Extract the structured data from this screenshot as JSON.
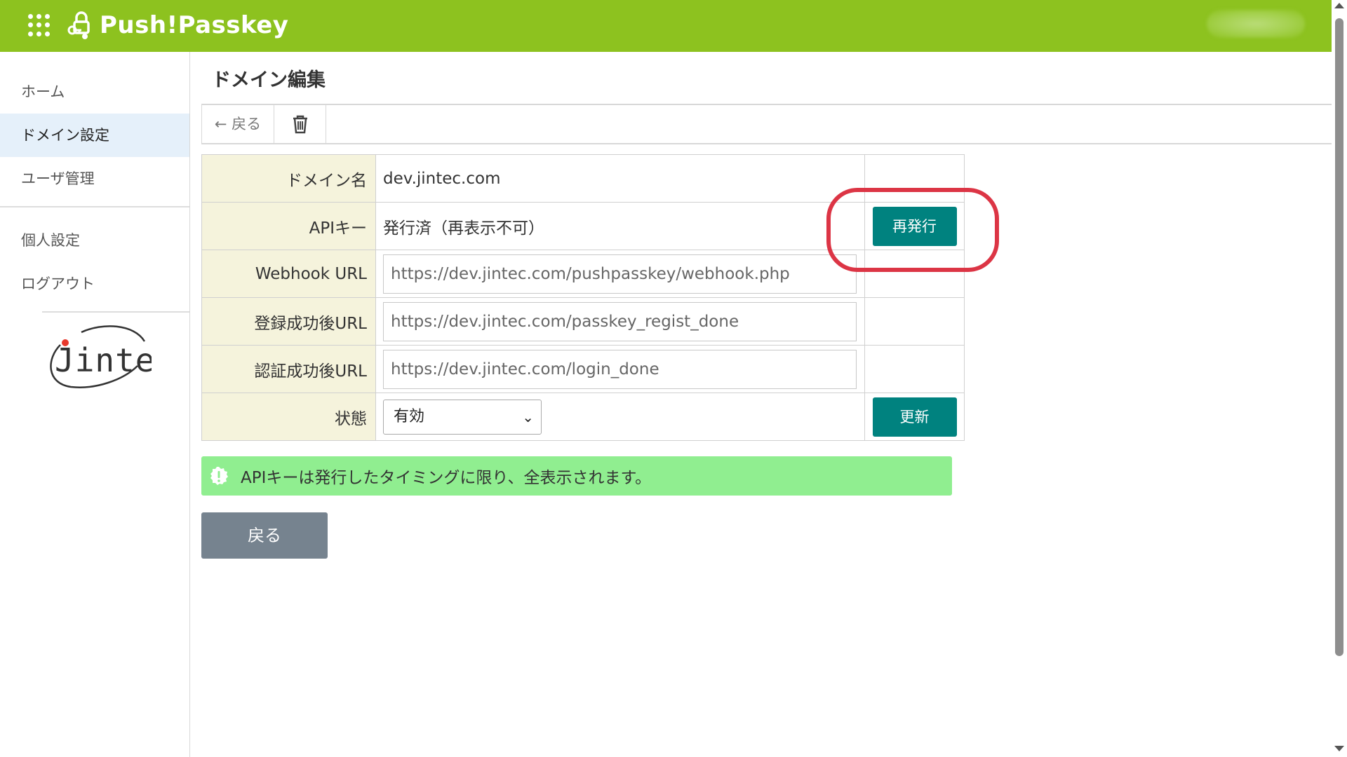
{
  "header": {
    "app_name": "Push!Passkey",
    "apps_icon": "apps-grid-icon",
    "logo_icon": "passkey-lock-icon",
    "bg_color": "#8dc21f"
  },
  "sidebar": {
    "items": [
      {
        "label": "ホーム",
        "active": false
      },
      {
        "label": "ドメイン設定",
        "active": true
      },
      {
        "label": "ユーザ管理",
        "active": false
      },
      {
        "label": "個人設定",
        "active": false
      },
      {
        "label": "ログアウト",
        "active": false
      }
    ],
    "logo_text": "Jintec"
  },
  "page": {
    "title": "ドメイン編集"
  },
  "toolbar": {
    "back_label": "← 戻る",
    "trash_icon": "trash-icon"
  },
  "form": {
    "domain_label": "ドメイン名",
    "domain_value": "dev.jintec.com",
    "api_key_label": "APIキー",
    "api_key_value": "発行済（再表示不可）",
    "reissue_button": "再発行",
    "webhook_label": "Webhook URL",
    "webhook_value": "https://dev.jintec.com/pushpasskey/webhook.php",
    "reg_success_label": "登録成功後URL",
    "reg_success_value": "https://dev.jintec.com/passkey_regist_done",
    "auth_success_label": "認証成功後URL",
    "auth_success_value": "https://dev.jintec.com/login_done",
    "status_label": "状態",
    "status_value": "有効",
    "update_button": "更新"
  },
  "alert": {
    "icon": "exclamation-circle-icon",
    "text": "APIキーは発行したタイミングに限り、全表示されます。"
  },
  "back_button": "戻る",
  "colors": {
    "accent_teal": "#00827f",
    "highlight_red": "#dc3545",
    "alert_green": "#90ee90",
    "label_bg": "#f5f3dc",
    "back_gray": "#76838f"
  }
}
